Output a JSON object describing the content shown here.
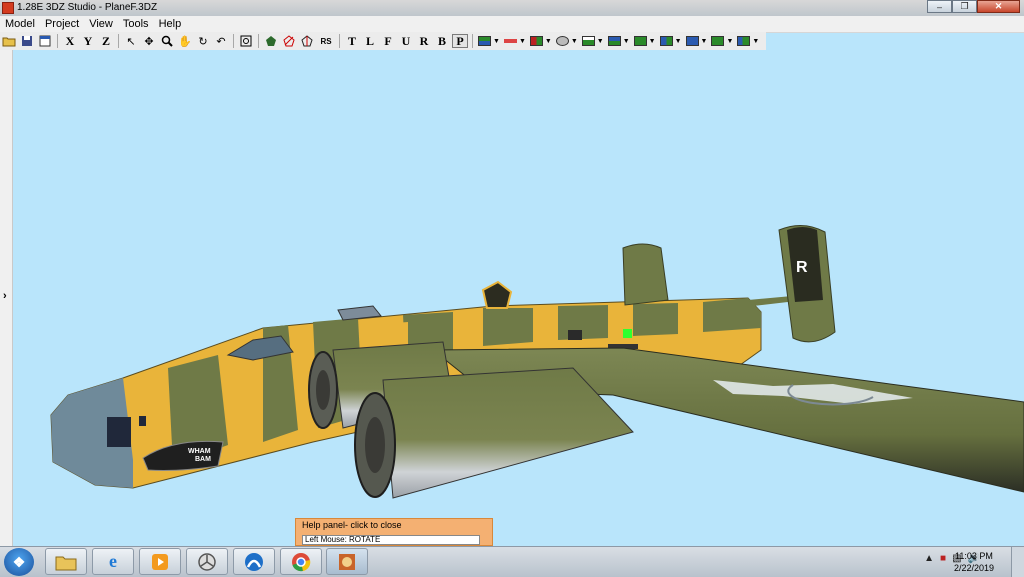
{
  "window": {
    "title": "1.28E 3DZ Studio - PlaneF.3DZ"
  },
  "menu": [
    "Model",
    "Project",
    "View",
    "Tools",
    "Help"
  ],
  "toolbar": {
    "axis_labels": [
      "X",
      "Y",
      "Z"
    ],
    "rs_label": "RS",
    "view_letters": [
      "T",
      "L",
      "F",
      "U",
      "R",
      "B",
      "P"
    ],
    "pressed_letter": "P"
  },
  "plane": {
    "nose_art_text_1": "WHAM",
    "nose_art_text_2": "BAM",
    "tail_letter": "R"
  },
  "help_panel": {
    "header": "Help panel- click to close",
    "line": "Left Mouse: ROTATE"
  },
  "taskbar": {
    "time": "11:03 PM",
    "date": "2/22/2019"
  },
  "colors": {
    "sky": "#b9e5fb",
    "olive": "#6f7a47",
    "yellow": "#e9b43a",
    "help_bg": "#f4b072"
  }
}
